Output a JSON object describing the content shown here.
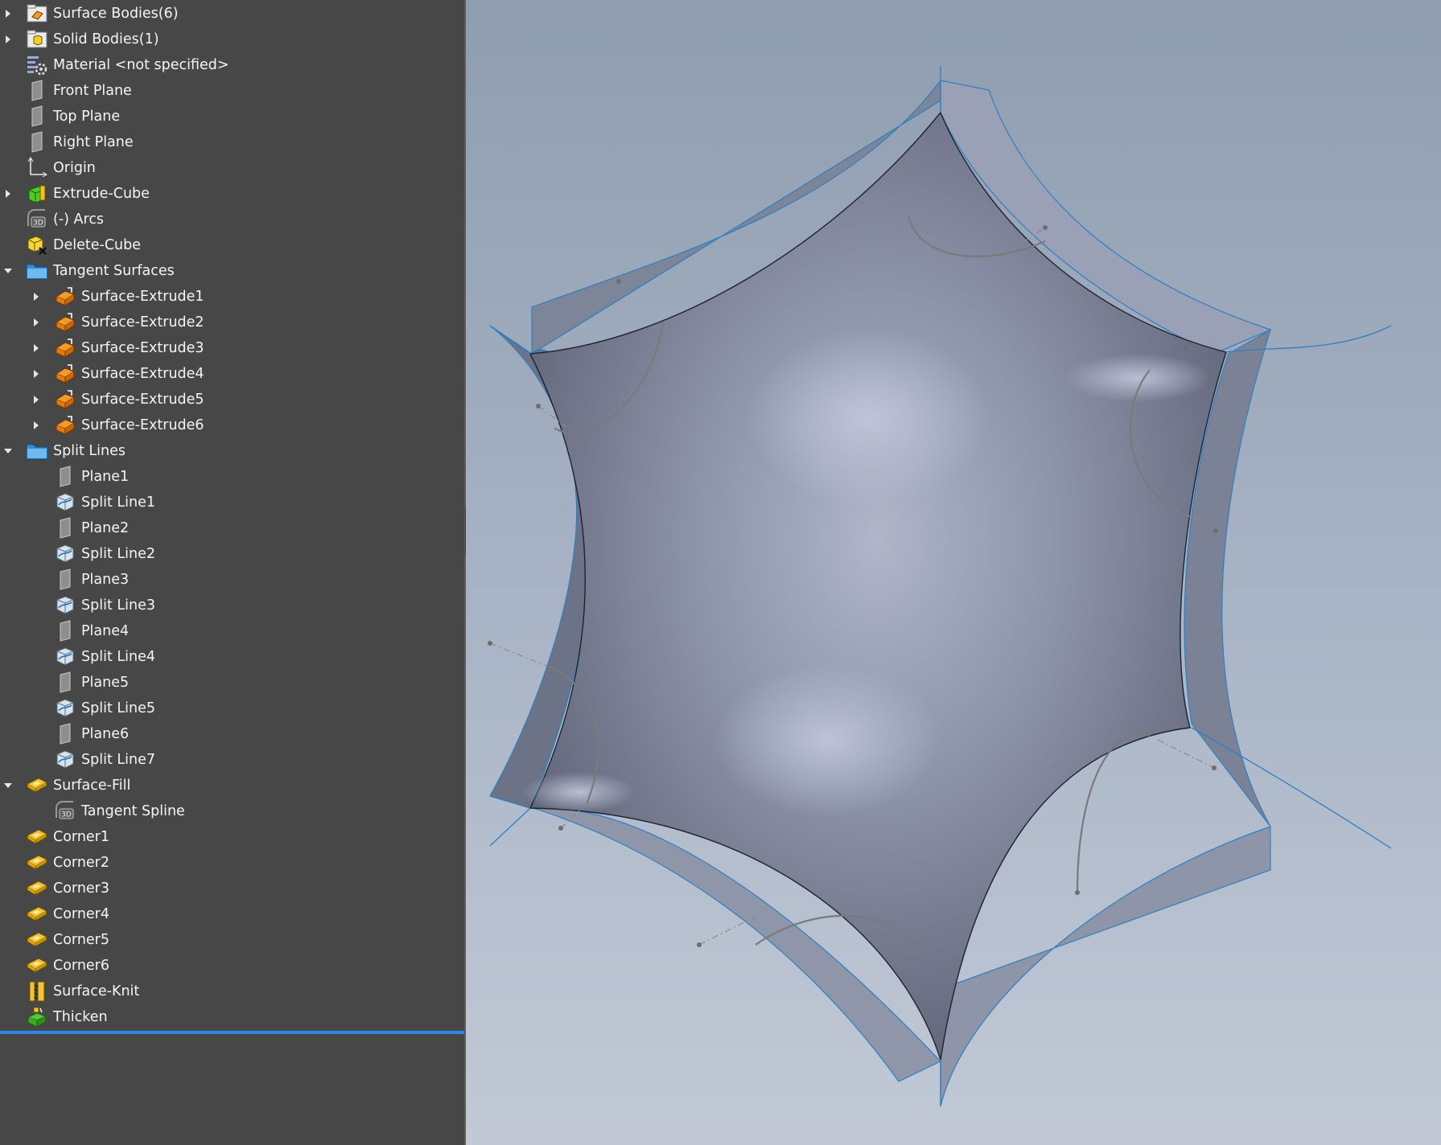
{
  "feature_tree": {
    "items": [
      {
        "label": "Surface Bodies(6)",
        "icon": "surface-bodies-folder-icon",
        "name": "tree-item-surface-bodies",
        "expander": "collapsed",
        "level": 0
      },
      {
        "label": "Solid Bodies(1)",
        "icon": "solid-bodies-folder-icon",
        "name": "tree-item-solid-bodies",
        "expander": "collapsed",
        "level": 0
      },
      {
        "label": "Material <not specified>",
        "icon": "material-icon",
        "name": "tree-item-material",
        "expander": "none",
        "level": 0
      },
      {
        "label": "Front Plane",
        "icon": "plane-icon",
        "name": "tree-item-front-plane",
        "expander": "none",
        "level": 0
      },
      {
        "label": "Top Plane",
        "icon": "plane-icon",
        "name": "tree-item-top-plane",
        "expander": "none",
        "level": 0
      },
      {
        "label": "Right Plane",
        "icon": "plane-icon",
        "name": "tree-item-right-plane",
        "expander": "none",
        "level": 0
      },
      {
        "label": "Origin",
        "icon": "origin-icon",
        "name": "tree-item-origin",
        "expander": "none",
        "level": 0
      },
      {
        "label": "Extrude-Cube",
        "icon": "extrude-icon",
        "name": "tree-item-extrude-cube",
        "expander": "collapsed",
        "level": 0
      },
      {
        "label": "(-) Arcs",
        "icon": "3d-sketch-icon",
        "name": "tree-item-arcs",
        "expander": "none",
        "level": 0
      },
      {
        "label": "Delete-Cube",
        "icon": "delete-body-icon",
        "name": "tree-item-delete-cube",
        "expander": "none",
        "level": 0
      },
      {
        "label": "Tangent Surfaces",
        "icon": "folder-icon",
        "name": "tree-item-tangent-surfaces",
        "expander": "expanded",
        "level": 0
      },
      {
        "label": "Surface-Extrude1",
        "icon": "surface-extrude-icon",
        "name": "tree-item-surface-extrude1",
        "expander": "collapsed",
        "level": 1
      },
      {
        "label": "Surface-Extrude2",
        "icon": "surface-extrude-icon",
        "name": "tree-item-surface-extrude2",
        "expander": "collapsed",
        "level": 1
      },
      {
        "label": "Surface-Extrude3",
        "icon": "surface-extrude-icon",
        "name": "tree-item-surface-extrude3",
        "expander": "collapsed",
        "level": 1
      },
      {
        "label": "Surface-Extrude4",
        "icon": "surface-extrude-icon",
        "name": "tree-item-surface-extrude4",
        "expander": "collapsed",
        "level": 1
      },
      {
        "label": "Surface-Extrude5",
        "icon": "surface-extrude-icon",
        "name": "tree-item-surface-extrude5",
        "expander": "collapsed",
        "level": 1
      },
      {
        "label": "Surface-Extrude6",
        "icon": "surface-extrude-icon",
        "name": "tree-item-surface-extrude6",
        "expander": "collapsed",
        "level": 1
      },
      {
        "label": "Split Lines",
        "icon": "folder-icon",
        "name": "tree-item-split-lines",
        "expander": "expanded",
        "level": 0
      },
      {
        "label": "Plane1",
        "icon": "plane-icon",
        "name": "tree-item-plane1",
        "expander": "none",
        "level": 1
      },
      {
        "label": "Split Line1",
        "icon": "split-line-icon",
        "name": "tree-item-split-line1",
        "expander": "none",
        "level": 1
      },
      {
        "label": "Plane2",
        "icon": "plane-icon",
        "name": "tree-item-plane2",
        "expander": "none",
        "level": 1
      },
      {
        "label": "Split Line2",
        "icon": "split-line-icon",
        "name": "tree-item-split-line2",
        "expander": "none",
        "level": 1
      },
      {
        "label": "Plane3",
        "icon": "plane-icon",
        "name": "tree-item-plane3",
        "expander": "none",
        "level": 1
      },
      {
        "label": "Split Line3",
        "icon": "split-line-icon",
        "name": "tree-item-split-line3",
        "expander": "none",
        "level": 1
      },
      {
        "label": "Plane4",
        "icon": "plane-icon",
        "name": "tree-item-plane4",
        "expander": "none",
        "level": 1
      },
      {
        "label": "Split Line4",
        "icon": "split-line-icon",
        "name": "tree-item-split-line4",
        "expander": "none",
        "level": 1
      },
      {
        "label": "Plane5",
        "icon": "plane-icon",
        "name": "tree-item-plane5",
        "expander": "none",
        "level": 1
      },
      {
        "label": "Split Line5",
        "icon": "split-line-icon",
        "name": "tree-item-split-line5",
        "expander": "none",
        "level": 1
      },
      {
        "label": "Plane6",
        "icon": "plane-icon",
        "name": "tree-item-plane6",
        "expander": "none",
        "level": 1
      },
      {
        "label": "Split Line7",
        "icon": "split-line-icon",
        "name": "tree-item-split-line7",
        "expander": "none",
        "level": 1
      },
      {
        "label": "Surface-Fill",
        "icon": "surface-fill-icon",
        "name": "tree-item-surface-fill",
        "expander": "expanded",
        "level": 0
      },
      {
        "label": "Tangent Spline",
        "icon": "3d-sketch-icon",
        "name": "tree-item-tangent-spline",
        "expander": "none",
        "level": 1
      },
      {
        "label": "Corner1",
        "icon": "surface-fill-icon",
        "name": "tree-item-corner1",
        "expander": "none",
        "level": 0
      },
      {
        "label": "Corner2",
        "icon": "surface-fill-icon",
        "name": "tree-item-corner2",
        "expander": "none",
        "level": 0
      },
      {
        "label": "Corner3",
        "icon": "surface-fill-icon",
        "name": "tree-item-corner3",
        "expander": "none",
        "level": 0
      },
      {
        "label": "Corner4",
        "icon": "surface-fill-icon",
        "name": "tree-item-corner4",
        "expander": "none",
        "level": 0
      },
      {
        "label": "Corner5",
        "icon": "surface-fill-icon",
        "name": "tree-item-corner5",
        "expander": "none",
        "level": 0
      },
      {
        "label": "Corner6",
        "icon": "surface-fill-icon",
        "name": "tree-item-corner6",
        "expander": "none",
        "level": 0
      },
      {
        "label": "Surface-Knit",
        "icon": "surface-knit-icon",
        "name": "tree-item-surface-knit",
        "expander": "none",
        "level": 0
      },
      {
        "label": "Thicken",
        "icon": "thicken-icon",
        "name": "tree-item-thicken",
        "expander": "none",
        "level": 0
      }
    ]
  },
  "colors": {
    "panel_bg": "#474747",
    "text": "#f4f4f4",
    "rollback_bar": "#2f87e6",
    "viewport_top": "#8f9db0",
    "viewport_bottom": "#c2c9d6",
    "model_face": "#8a91a6",
    "model_edge": "#2f7fc0"
  }
}
